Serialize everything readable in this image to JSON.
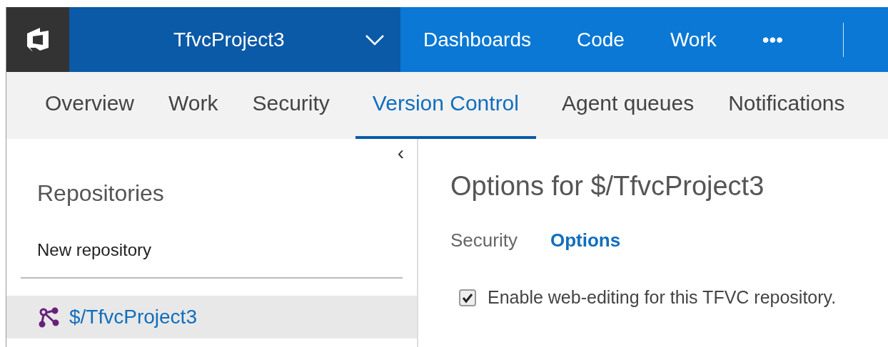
{
  "header": {
    "project": "TfvcProject3",
    "nav": [
      {
        "label": "Dashboards"
      },
      {
        "label": "Code"
      },
      {
        "label": "Work"
      },
      {
        "label": "•••"
      }
    ]
  },
  "tabs": [
    {
      "label": "Overview",
      "selected": false
    },
    {
      "label": "Work",
      "selected": false
    },
    {
      "label": "Security",
      "selected": false
    },
    {
      "label": "Version Control",
      "selected": true
    },
    {
      "label": "Agent queues",
      "selected": false
    },
    {
      "label": "Notifications",
      "selected": false
    }
  ],
  "sidebar": {
    "collapse": "‹",
    "title": "Repositories",
    "new_link": "New repository",
    "items": [
      {
        "label": "$/TfvcProject3",
        "selected": true
      }
    ]
  },
  "main": {
    "title": "Options for $/TfvcProject3",
    "subtabs": [
      {
        "label": "Security",
        "selected": false
      },
      {
        "label": "Options",
        "selected": true
      }
    ],
    "options": [
      {
        "label": "Enable web-editing for this TFVC repository.",
        "checked": true
      }
    ]
  }
}
